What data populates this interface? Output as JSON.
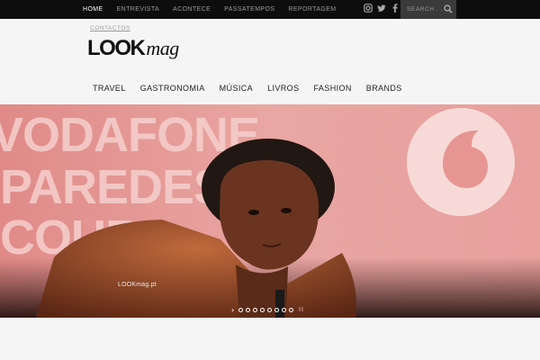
{
  "topnav": {
    "items": [
      {
        "label": "HOME",
        "active": true
      },
      {
        "label": "ENTREVISTA",
        "active": false
      },
      {
        "label": "ACONTECE",
        "active": false
      },
      {
        "label": "PASSATEMPOS",
        "active": false
      },
      {
        "label": "REPORTAGEM",
        "active": false
      }
    ]
  },
  "social": [
    "instagram-icon",
    "twitter-icon",
    "facebook-icon"
  ],
  "search": {
    "placeholder": "SEARCH . . ."
  },
  "header": {
    "contact": "CONTACTOS",
    "logo_bold": "LOOK",
    "logo_italic": "mag"
  },
  "mainnav": {
    "items": [
      "TRAVEL",
      "GASTRONOMIA",
      "MÚSICA",
      "LIVROS",
      "FASHION",
      "BRANDS"
    ]
  },
  "hero": {
    "banner_lines": [
      "VODAFONE",
      "PAREDES",
      "COURA"
    ],
    "watermark": "LOOKmag.pt",
    "slide_count": 8,
    "active_slide": 1
  },
  "colors": {
    "topbar": "#0d0d0d",
    "accent_hero": "#e7a2a0",
    "text_dark": "#222222"
  }
}
